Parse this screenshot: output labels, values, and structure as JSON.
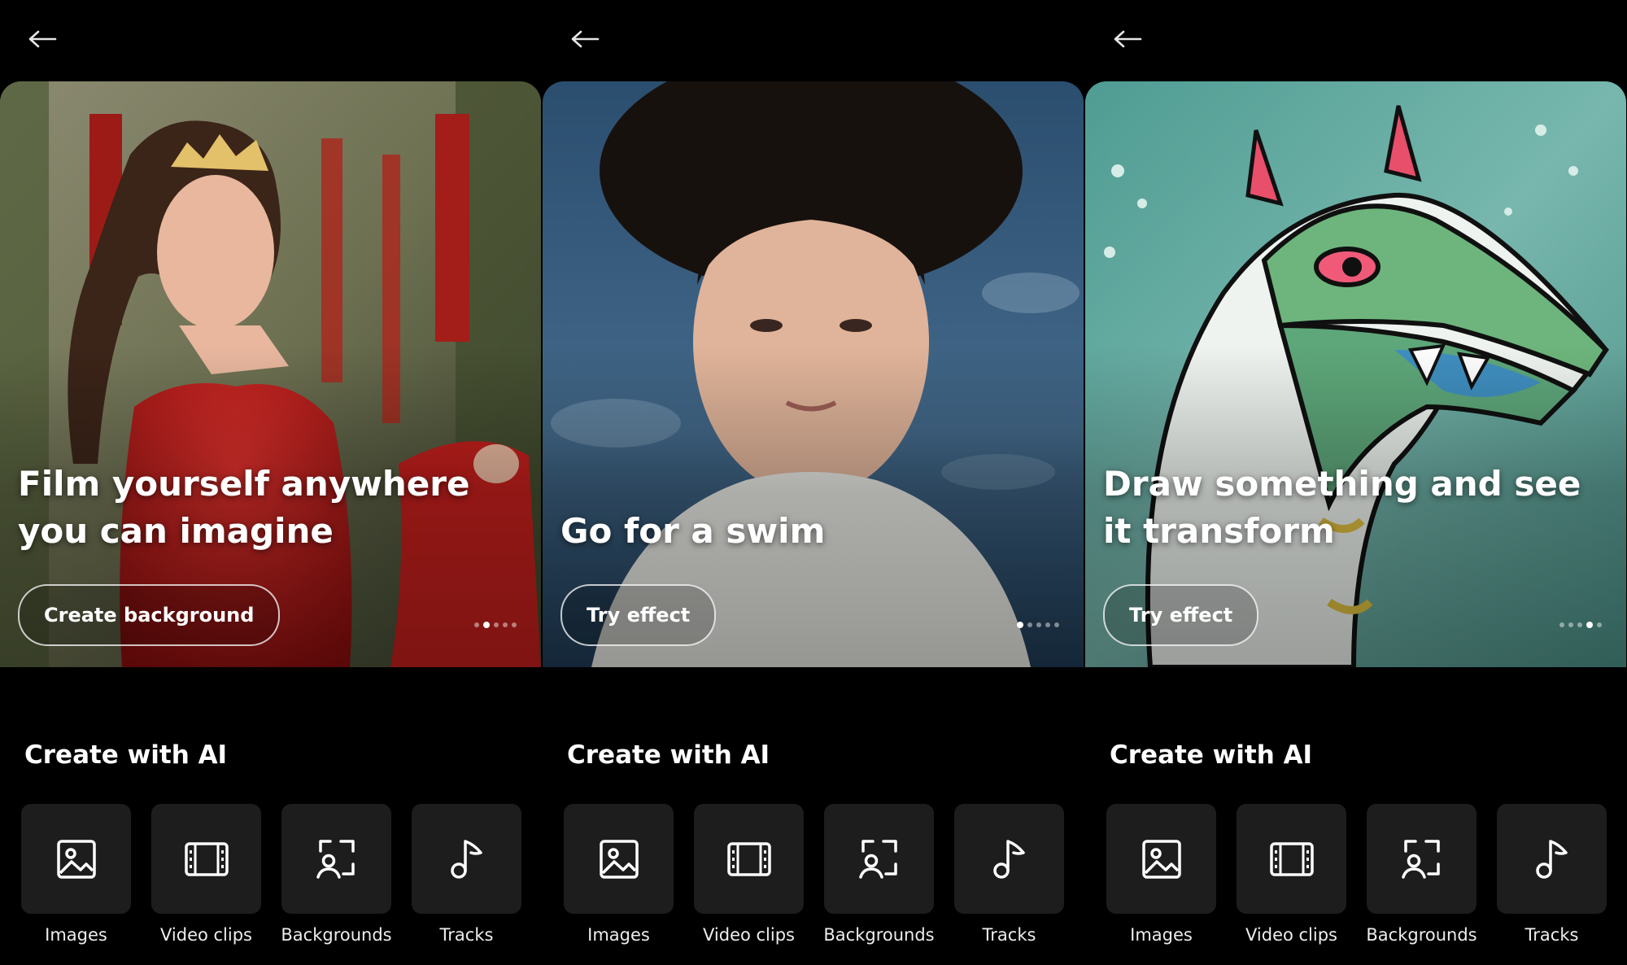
{
  "panels": [
    {
      "card": {
        "title": "Film yourself anywhere you can imagine",
        "button_label": "Create background",
        "active_dot": 1,
        "image_description": "woman-in-red-dress-with-crown-castle-background"
      }
    },
    {
      "card": {
        "title": "Go for a swim",
        "button_label": "Try effect",
        "active_dot": 0,
        "image_description": "woman-face-underwater-effect"
      }
    },
    {
      "card": {
        "title": "Draw something and see it transform",
        "button_label": "Try effect",
        "active_dot": 3,
        "image_description": "watercolor-green-dragon-drawing"
      }
    }
  ],
  "section_title": "Create with AI",
  "tiles": [
    {
      "label": "Images",
      "icon": "image-icon"
    },
    {
      "label": "Video clips",
      "icon": "film-icon"
    },
    {
      "label": "Backgrounds",
      "icon": "person-frame-icon"
    },
    {
      "label": "Tracks",
      "icon": "music-note-icon"
    }
  ],
  "colors": {
    "background": "#000000",
    "tile_background": "#1d1d1d",
    "text": "#ffffff"
  }
}
